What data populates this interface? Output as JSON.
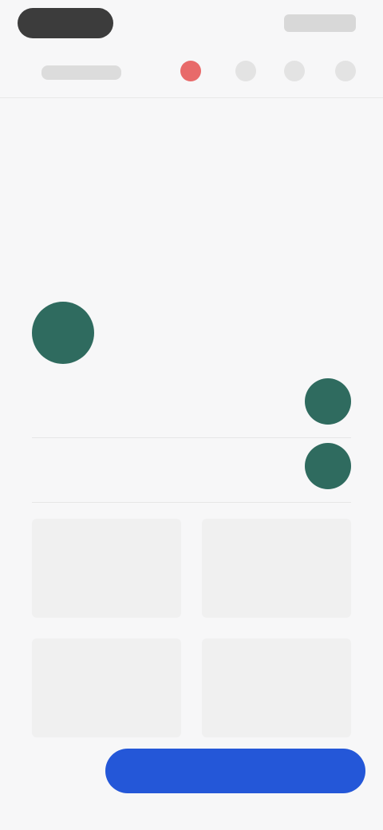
{
  "topbar": {
    "logo_label": "",
    "right_label": ""
  },
  "toolbar": {
    "back_label": "",
    "icons": [
      "like-icon",
      "comment-icon",
      "share-icon",
      "more-icon"
    ]
  },
  "content": {
    "title": "",
    "meta": "",
    "description": "",
    "link_text": "",
    "profile": {
      "name": "",
      "subtitle": ""
    },
    "list": [
      {
        "label": "",
        "sub": ""
      },
      {
        "label": "",
        "sub": ""
      }
    ],
    "cards": [
      {
        "title": "",
        "subtitle": ""
      },
      {
        "title": "",
        "subtitle": ""
      },
      {
        "title": "",
        "subtitle": ""
      },
      {
        "title": "",
        "subtitle": ""
      }
    ]
  },
  "footer": {
    "secondary_label": "",
    "primary_label": ""
  }
}
